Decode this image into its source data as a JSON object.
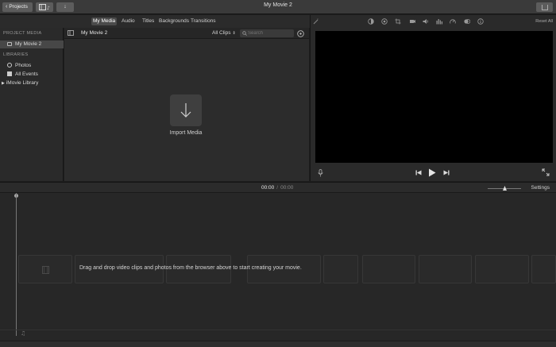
{
  "toolbar": {
    "projects_label": "Projects",
    "window_title": "My Movie 2"
  },
  "media_tabs": [
    "My Media",
    "Audio",
    "Titles",
    "Backgrounds",
    "Transitions"
  ],
  "sidebar": {
    "project_media_header": "PROJECT MEDIA",
    "project_item": "My Movie 2",
    "libraries_header": "LIBRARIES",
    "library_items": [
      "Photos",
      "All Events"
    ],
    "imovie_library": "iMovie Library"
  },
  "browser": {
    "title": "My Movie 2",
    "filter": "All Clips",
    "search_placeholder": "Search",
    "import_label": "Import Media"
  },
  "viewer": {
    "reset_all": "Reset All"
  },
  "timeline": {
    "current_time": "00:00",
    "separator": "/",
    "duration": "00:00",
    "settings": "Settings",
    "drop_hint": "Drag and drop video clips and photos from the browser above to start creating your movie."
  },
  "colors": {
    "background": "#1e1e1e",
    "panel": "#2c2c2c",
    "selection": "#474747",
    "video": "#000000"
  }
}
